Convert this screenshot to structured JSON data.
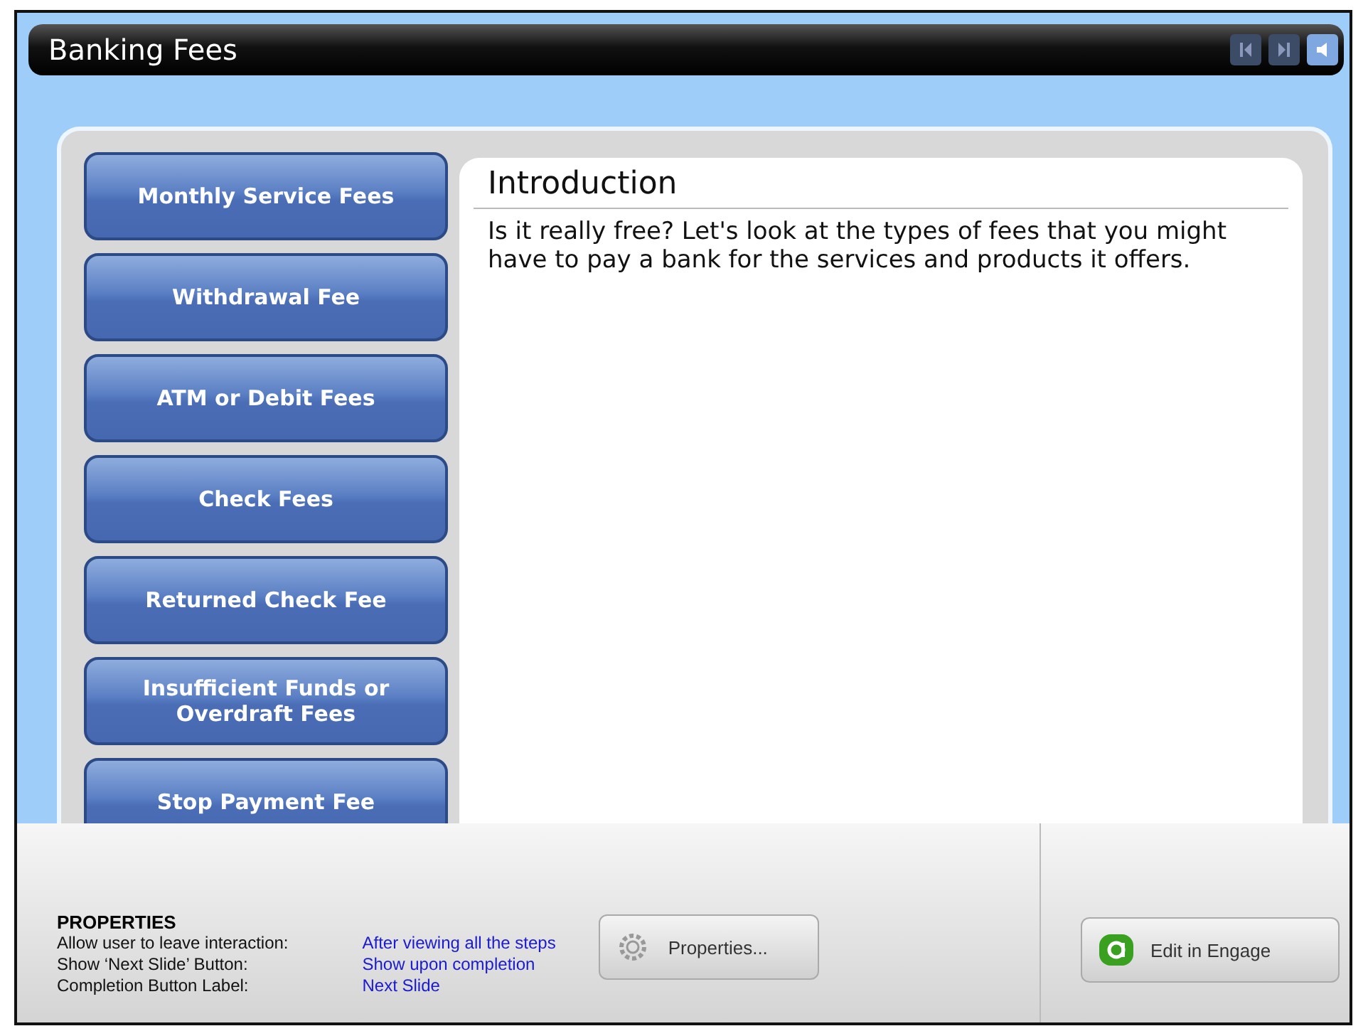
{
  "title_bar": {
    "title": "Banking Fees",
    "controls": [
      {
        "kind": "previous",
        "disabled": true
      },
      {
        "kind": "next",
        "disabled": true
      },
      {
        "kind": "sound",
        "disabled": false
      }
    ]
  },
  "menu": [
    {
      "label": "Monthly Service Fees"
    },
    {
      "label": "Withdrawal Fee"
    },
    {
      "label": "ATM or Debit Fees"
    },
    {
      "label": "Check Fees"
    },
    {
      "label": "Returned Check Fee"
    },
    {
      "label": "Insufficient  Funds or Overdraft Fees"
    },
    {
      "label": "Stop Payment Fee"
    }
  ],
  "content": {
    "heading": "Introduction",
    "body": "Is it really free? Let's look at the types of fees that you might have to pay a bank for the services and products it offers."
  },
  "properties": {
    "heading": "PROPERTIES",
    "rows": [
      {
        "label": "Allow user to leave interaction:",
        "value": "After viewing all the steps"
      },
      {
        "label": "Show ‘Next Slide’ Button:",
        "value": "Show upon completion"
      },
      {
        "label": "Completion Button Label:",
        "value": "Next Slide"
      }
    ],
    "buttons": [
      {
        "kind": "properties",
        "label": "Properties..."
      },
      {
        "kind": "engage",
        "label": "Edit in Engage"
      }
    ]
  }
}
